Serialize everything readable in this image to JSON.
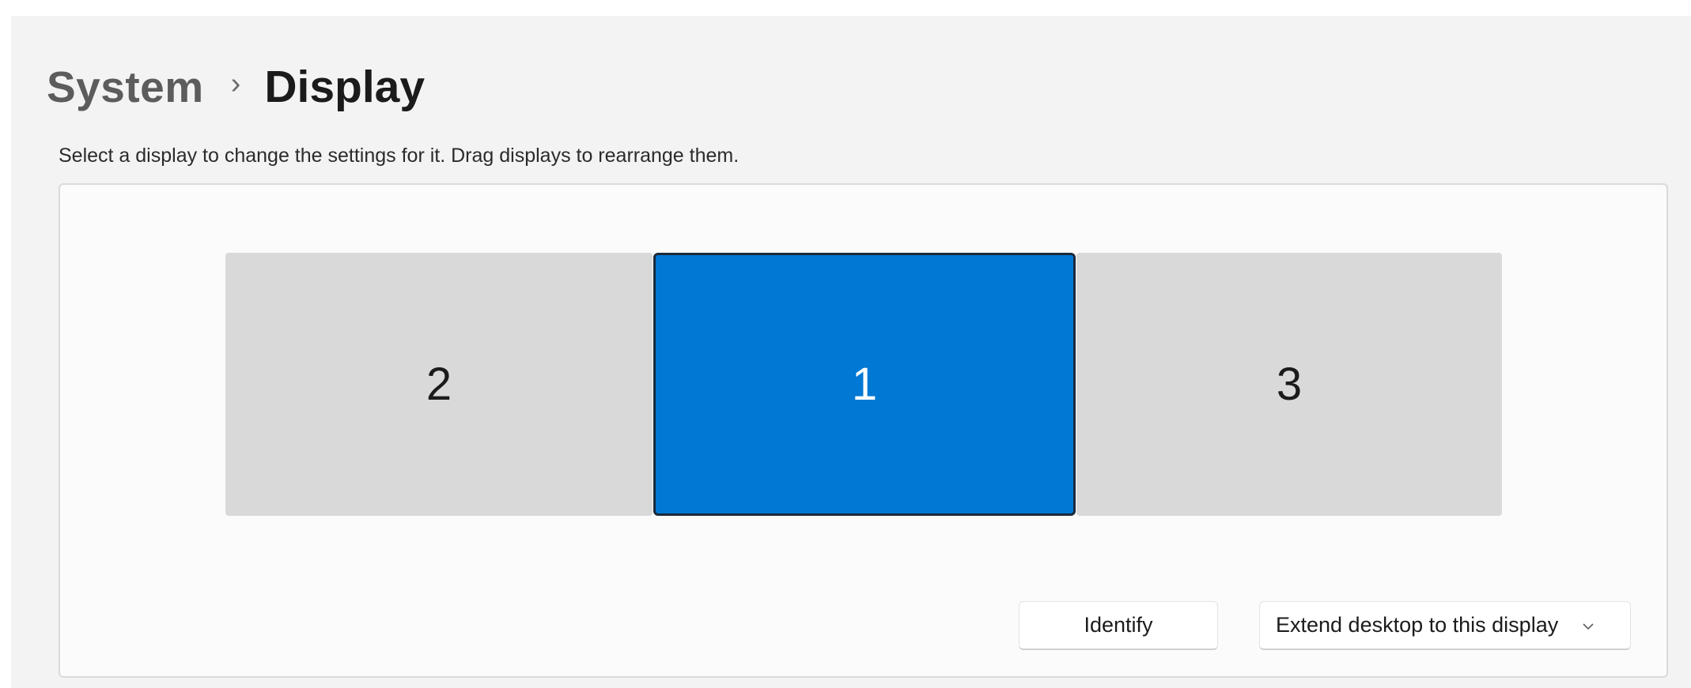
{
  "breadcrumb": {
    "parent": "System",
    "separator": "›",
    "current": "Display"
  },
  "instructions": "Select a display to change the settings for it. Drag displays to rearrange them.",
  "displays": [
    {
      "label": "2",
      "selected": false
    },
    {
      "label": "1",
      "selected": true
    },
    {
      "label": "3",
      "selected": false
    }
  ],
  "buttons": {
    "identify": "Identify",
    "mode": "Extend desktop to this display"
  },
  "icons": {
    "breadcrumb_separator": "chevron-right-icon",
    "mode_dropdown": "chevron-down-icon"
  },
  "colors": {
    "accent": "#0078d4",
    "inactive_display": "#d9d9d9"
  }
}
